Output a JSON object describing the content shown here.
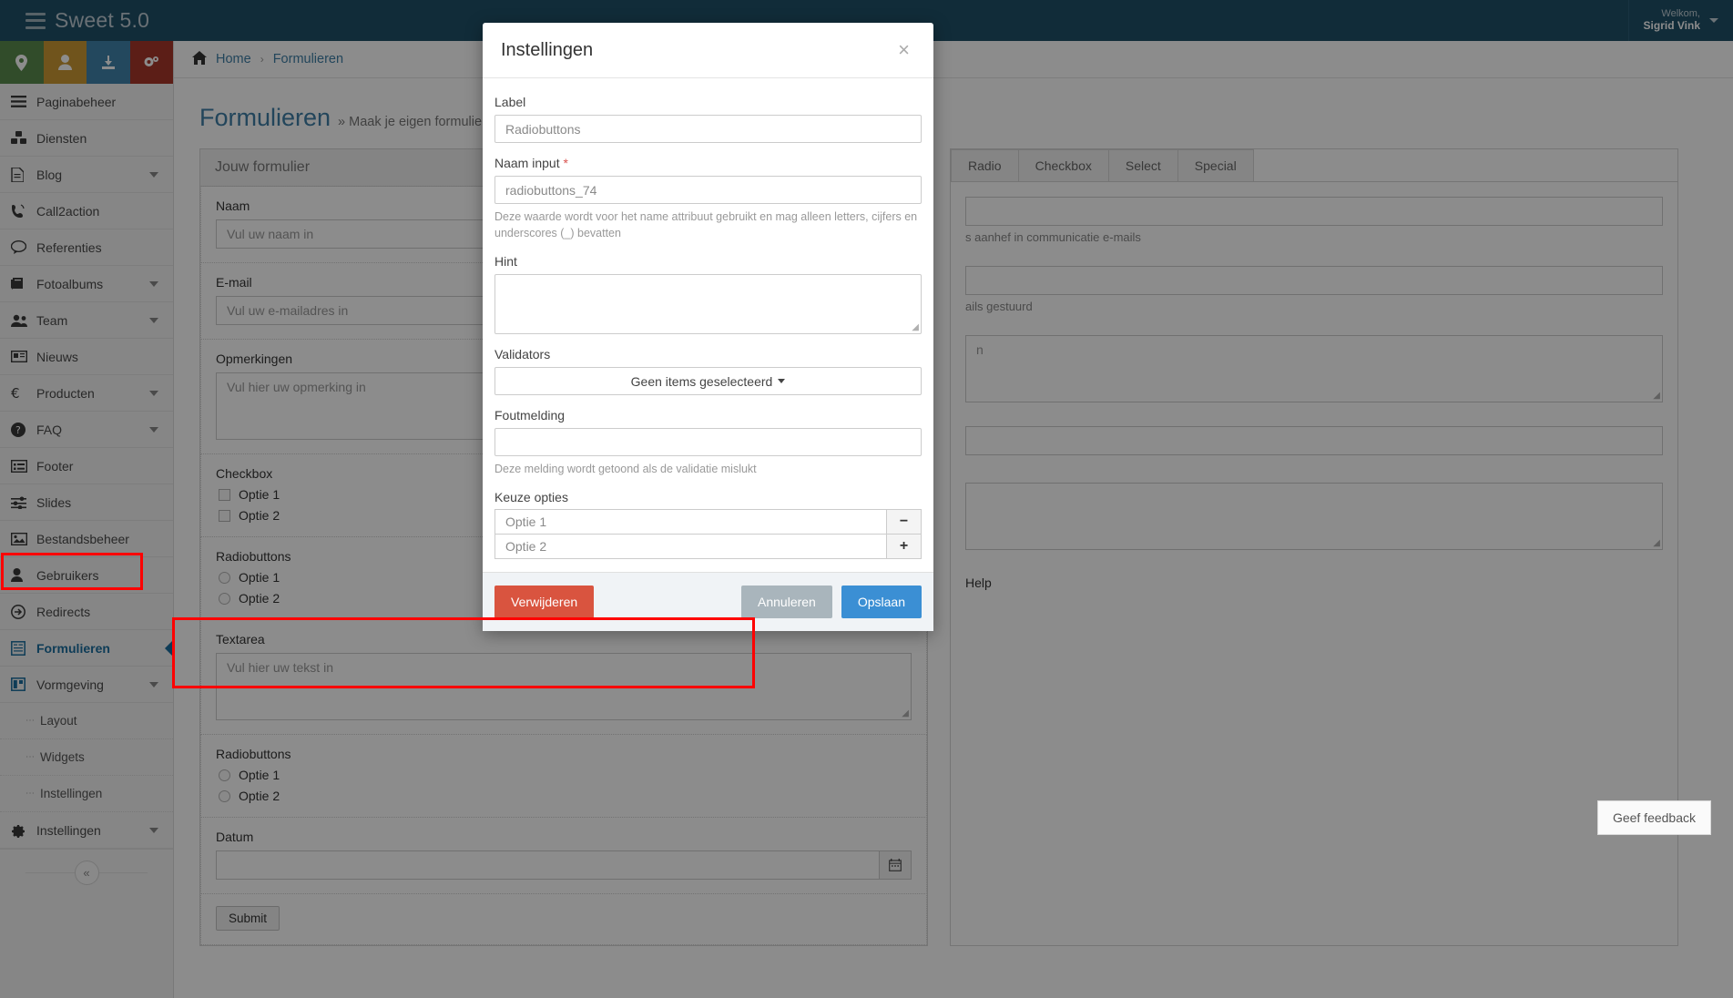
{
  "topbar": {
    "brand": "Sweet 5.0",
    "brand_icon": "stacked-lines-icon",
    "welcome_line1": "Welkom,",
    "welcome_line2": "Sigrid Vink"
  },
  "quickbar": [
    {
      "name": "location",
      "glyph": "●"
    },
    {
      "name": "user",
      "glyph": "●"
    },
    {
      "name": "download",
      "glyph": "●"
    },
    {
      "name": "settings",
      "glyph": "●"
    }
  ],
  "sidebar": {
    "items": [
      {
        "label": "Paginabeheer",
        "icon": "hamburger-icon",
        "chevron": false,
        "active": false
      },
      {
        "label": "Diensten",
        "icon": "cubes-icon",
        "chevron": false,
        "active": false
      },
      {
        "label": "Blog",
        "icon": "document-icon",
        "chevron": true,
        "active": false
      },
      {
        "label": "Call2action",
        "icon": "phone-volume-icon",
        "chevron": false,
        "active": false
      },
      {
        "label": "Referenties",
        "icon": "comment-icon",
        "chevron": false,
        "active": false
      },
      {
        "label": "Fotoalbums",
        "icon": "photo-book-icon",
        "chevron": true,
        "active": false
      },
      {
        "label": "Team",
        "icon": "users-icon",
        "chevron": true,
        "active": false
      },
      {
        "label": "Nieuws",
        "icon": "newspaper-icon",
        "chevron": false,
        "active": false
      },
      {
        "label": "Producten",
        "icon": "euro-icon",
        "chevron": true,
        "active": false
      },
      {
        "label": "FAQ",
        "icon": "question-circle-icon",
        "chevron": true,
        "active": false
      },
      {
        "label": "Footer",
        "icon": "list-icon",
        "chevron": false,
        "active": false
      },
      {
        "label": "Slides",
        "icon": "sliders-icon",
        "chevron": false,
        "active": false
      },
      {
        "label": "Bestandsbeheer",
        "icon": "image-icon",
        "chevron": false,
        "active": false
      },
      {
        "label": "Gebruikers",
        "icon": "person-icon",
        "chevron": false,
        "active": false
      },
      {
        "label": "Redirects",
        "icon": "arrow-circle-right-icon",
        "chevron": false,
        "active": false
      },
      {
        "label": "Formulieren",
        "icon": "form-icon",
        "chevron": false,
        "active": true
      },
      {
        "label": "Vormgeving",
        "icon": "columns-icon",
        "chevron": true,
        "active": false
      }
    ],
    "subitems": [
      {
        "label": "Layout"
      },
      {
        "label": "Widgets"
      },
      {
        "label": "Instellingen"
      }
    ],
    "settings_item": {
      "label": "Instellingen",
      "icon": "gear-icon",
      "chevron": true
    },
    "collapse_glyph": "«"
  },
  "breadcrumb": {
    "home_icon": "home-icon",
    "home": "Home",
    "separator": "›",
    "current": "Formulieren"
  },
  "page": {
    "title": "Formulieren",
    "subtitle": "» Maak je eigen formulier door velden naar h"
  },
  "form_canvas": {
    "panel_title": "Jouw formulier",
    "fields": [
      {
        "kind": "input",
        "label": "Naam",
        "placeholder": "Vul uw naam in"
      },
      {
        "kind": "input",
        "label": "E-mail",
        "placeholder": "Vul uw e-mailadres in"
      },
      {
        "kind": "textarea",
        "label": "Opmerkingen",
        "placeholder": "Vul hier uw opmerking in"
      },
      {
        "kind": "checkbox",
        "label": "Checkbox",
        "options": [
          "Optie 1",
          "Optie 2"
        ]
      },
      {
        "kind": "radio",
        "label": "Radiobuttons",
        "options": [
          "Optie 1",
          "Optie 2"
        ]
      },
      {
        "kind": "textarea",
        "label": "Textarea",
        "placeholder": "Vul hier uw tekst in"
      },
      {
        "kind": "radio",
        "label": "Radiobuttons",
        "options": [
          "Optie 1",
          "Optie 2"
        ],
        "highlighted": true
      },
      {
        "kind": "date",
        "label": "Datum",
        "placeholder": "",
        "icon": "calendar-icon"
      }
    ],
    "submit_label": "Submit"
  },
  "side_panel": {
    "tabs": [
      {
        "label": "Radio",
        "active": false
      },
      {
        "label": "Checkbox",
        "active": false
      },
      {
        "label": "Select",
        "active": false
      },
      {
        "label": "Special",
        "active": false
      }
    ],
    "help_texts": [
      "s aanhef in communicatie e-mails",
      "ails gestuurd",
      "n"
    ],
    "help_label": "Help"
  },
  "modal": {
    "title": "Instellingen",
    "close_glyph": "×",
    "label_field": {
      "label": "Label",
      "value": "Radiobuttons"
    },
    "name_field": {
      "label": "Naam input",
      "required_mark": "*",
      "value": "radiobuttons_74",
      "help": "Deze waarde wordt voor het name attribuut gebruikt en mag alleen letters, cijfers en underscores (_) bevatten"
    },
    "hint_field": {
      "label": "Hint",
      "value": ""
    },
    "validators_field": {
      "label": "Validators",
      "selected_text": "Geen items geselecteerd"
    },
    "error_field": {
      "label": "Foutmelding",
      "value": "",
      "help": "Deze melding wordt getoond als de validatie mislukt"
    },
    "options_field": {
      "label": "Keuze opties",
      "options": [
        {
          "value": "Optie 1",
          "button": "−",
          "button_name": "remove-option-button"
        },
        {
          "value": "Optie 2",
          "button": "+",
          "button_name": "add-option-button"
        }
      ]
    },
    "buttons": {
      "delete": "Verwijderen",
      "cancel": "Annuleren",
      "save": "Opslaan"
    }
  },
  "feedback": {
    "label": "Geef feedback"
  },
  "colors": {
    "topbar": "#1f5068",
    "accent_link": "#3f7fa6",
    "active_nav": "#1b6d9e",
    "danger": "#d9543f",
    "primary": "#3b8fd4",
    "muted": "#a9b5bc",
    "highlight": "#ff0000"
  }
}
